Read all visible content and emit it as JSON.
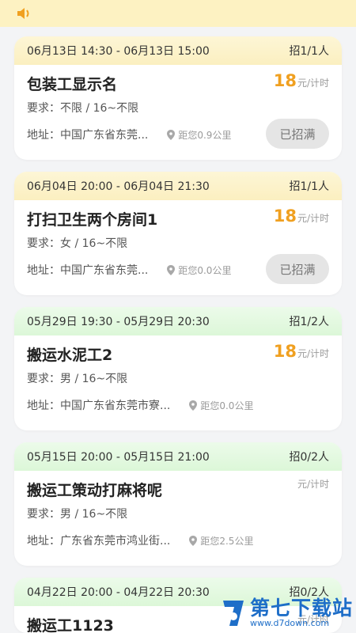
{
  "notice": {
    "icon": "speaker-icon",
    "color": "#f0a020"
  },
  "jobs": [
    {
      "time_range": "06月13日 14:30 - 06月13日 15:00",
      "recruit": "招1/1人",
      "title": "包装工显示名",
      "price_num": "18",
      "price_unit": "元/计时",
      "requirement": "要求：不限  / 16~不限",
      "address": "地址：中国广东省东莞...",
      "distance": "距您0.9公里",
      "status": "已招满",
      "theme": "yellow"
    },
    {
      "time_range": "06月04日 20:00 - 06月04日 21:30",
      "recruit": "招1/1人",
      "title": "打扫卫生两个房间1",
      "price_num": "18",
      "price_unit": "元/计时",
      "requirement": "要求：女  / 16~不限",
      "address": "地址：中国广东省东莞...",
      "distance": "距您0.0公里",
      "status": "已招满",
      "theme": "yellow"
    },
    {
      "time_range": "05月29日 19:30 - 05月29日 20:30",
      "recruit": "招1/2人",
      "title": "搬运水泥工2",
      "price_num": "18",
      "price_unit": "元/计时",
      "requirement": "要求：男  / 16~不限",
      "address": "地址：中国广东省东莞市寮...",
      "distance": "距您0.0公里",
      "status": "",
      "theme": "green"
    },
    {
      "time_range": "05月15日 20:00 - 05月15日 21:00",
      "recruit": "招0/2人",
      "title": "搬运工策动打麻将呢",
      "price_num": "",
      "price_unit": "元/计时",
      "requirement": "要求：男  / 16~不限",
      "address": "地址：广东省东莞市鸿业街...",
      "distance": "距您2.5公里",
      "status": "",
      "theme": "green"
    },
    {
      "time_range": "04月22日 20:00 - 04月22日 20:30",
      "recruit": "招0/2人",
      "title": "搬运工1123",
      "price_num": "",
      "price_unit": "元/计时",
      "requirement": "",
      "address": "",
      "distance": "",
      "status": "",
      "theme": "green"
    }
  ],
  "watermark": {
    "name": "第七下载站",
    "url": "www.d7down.com",
    "color": "#1e6ec8"
  }
}
